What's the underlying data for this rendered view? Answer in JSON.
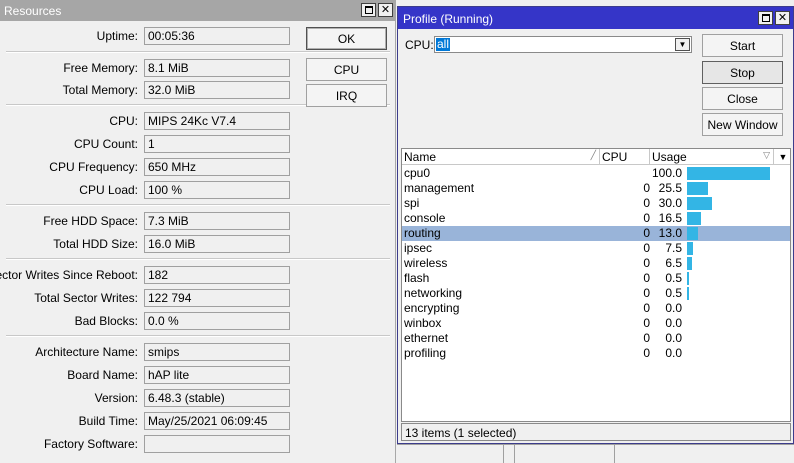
{
  "resources": {
    "title": "Resources",
    "buttons": {
      "ok": "OK",
      "cpu": "CPU",
      "irq": "IRQ"
    },
    "fields": [
      {
        "label": "Uptime:",
        "value": "00:05:36"
      },
      {
        "label": "Free Memory:",
        "value": "8.1 MiB"
      },
      {
        "label": "Total Memory:",
        "value": "32.0 MiB"
      },
      {
        "label": "CPU:",
        "value": "MIPS 24Kc V7.4"
      },
      {
        "label": "CPU Count:",
        "value": "1"
      },
      {
        "label": "CPU Frequency:",
        "value": "650 MHz"
      },
      {
        "label": "CPU Load:",
        "value": "100 %"
      },
      {
        "label": "Free HDD Space:",
        "value": "7.3 MiB"
      },
      {
        "label": "Total HDD Size:",
        "value": "16.0 MiB"
      },
      {
        "label": "Sector Writes Since Reboot:",
        "value": "182"
      },
      {
        "label": "Total Sector Writes:",
        "value": "122 794"
      },
      {
        "label": "Bad Blocks:",
        "value": "0.0 %"
      },
      {
        "label": "Architecture Name:",
        "value": "smips"
      },
      {
        "label": "Board Name:",
        "value": "hAP lite"
      },
      {
        "label": "Version:",
        "value": "6.48.3 (stable)"
      },
      {
        "label": "Build Time:",
        "value": "May/25/2021 06:09:45"
      },
      {
        "label": "Factory Software:",
        "value": ""
      }
    ]
  },
  "profile": {
    "title": "Profile (Running)",
    "cpu_label": "CPU:",
    "cpu_value": "all",
    "buttons": {
      "start": "Start",
      "stop": "Stop",
      "close": "Close",
      "new_window": "New Window"
    },
    "columns": {
      "name": "Name",
      "cpu": "CPU",
      "usage": "Usage"
    },
    "rows": [
      {
        "name": "cpu0",
        "cpu": "",
        "usage": "100.0",
        "pct": 100.0,
        "selected": false
      },
      {
        "name": "management",
        "cpu": "0",
        "usage": "25.5",
        "pct": 25.5,
        "selected": false
      },
      {
        "name": "spi",
        "cpu": "0",
        "usage": "30.0",
        "pct": 30.0,
        "selected": false
      },
      {
        "name": "console",
        "cpu": "0",
        "usage": "16.5",
        "pct": 16.5,
        "selected": false
      },
      {
        "name": "routing",
        "cpu": "0",
        "usage": "13.0",
        "pct": 13.0,
        "selected": true
      },
      {
        "name": "ipsec",
        "cpu": "0",
        "usage": "7.5",
        "pct": 7.5,
        "selected": false
      },
      {
        "name": "wireless",
        "cpu": "0",
        "usage": "6.5",
        "pct": 6.5,
        "selected": false
      },
      {
        "name": "flash",
        "cpu": "0",
        "usage": "0.5",
        "pct": 0.5,
        "selected": false
      },
      {
        "name": "networking",
        "cpu": "0",
        "usage": "0.5",
        "pct": 0.5,
        "selected": false
      },
      {
        "name": "encrypting",
        "cpu": "0",
        "usage": "0.0",
        "pct": 0.0,
        "selected": false
      },
      {
        "name": "winbox",
        "cpu": "0",
        "usage": "0.0",
        "pct": 0.0,
        "selected": false
      },
      {
        "name": "ethernet",
        "cpu": "0",
        "usage": "0.0",
        "pct": 0.0,
        "selected": false
      },
      {
        "name": "profiling",
        "cpu": "0",
        "usage": "0.0",
        "pct": 0.0,
        "selected": false
      }
    ],
    "status": "13 items (1 selected)",
    "bar_color": "#33b5e5",
    "selected_row_color": "#99b4d9"
  }
}
